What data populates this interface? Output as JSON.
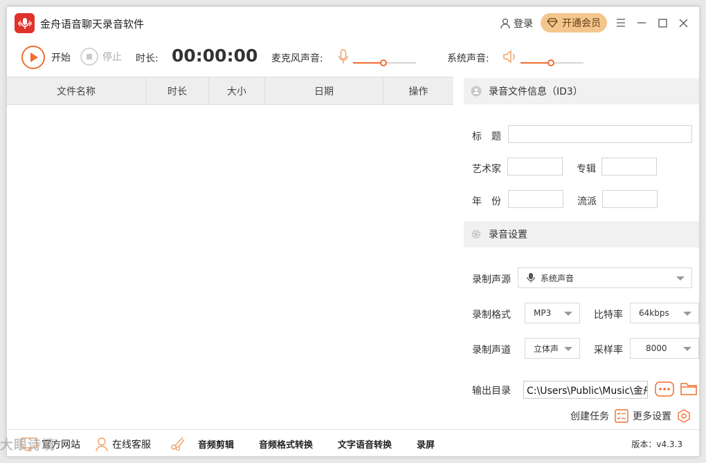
{
  "app": {
    "title": "金舟语音聊天录音软件"
  },
  "header": {
    "login": "登录",
    "vip": "开通会员"
  },
  "toolbar": {
    "start": "开始",
    "stop": "停止",
    "duration_label": "时长:",
    "duration": "00:00:00",
    "mic_label": "麦克风声音:",
    "mic_level": 0.48,
    "system_label": "系统声音:",
    "system_level": 0.48
  },
  "list": {
    "columns": [
      "文件名称",
      "时长",
      "大小",
      "日期",
      "操作"
    ]
  },
  "id3": {
    "header": "录音文件信息（ID3）",
    "title_label": "标　题",
    "artist_label": "艺术家",
    "album_label": "专辑",
    "year_label": "年　份",
    "genre_label": "流派"
  },
  "settings": {
    "header": "录音设置",
    "source_label": "录制声源",
    "source_value": "系统声音",
    "format_label": "录制格式",
    "format_value": "MP3",
    "bitrate_label": "比特率",
    "bitrate_value": "64kbps",
    "channel_label": "录制声道",
    "channel_value": "立体声",
    "samplerate_label": "采样率",
    "samplerate_value": "8000",
    "output_label": "输出目录",
    "output_value": "C:\\Users\\Public\\Music\\金舟",
    "create_task": "创建任务",
    "more_settings": "更多设置"
  },
  "footer": {
    "website": "官方网站",
    "support": "在线客服",
    "audio_edit": "音频剪辑",
    "format_convert": "音频格式转换",
    "tts": "文字语音转换",
    "screen_record": "录屏",
    "version": "版本：v4.3.3"
  },
  "watermark": "大眼诗境",
  "colors": {
    "accent": "#ef6c2d",
    "vip": "#f3c68e",
    "logo": "#e0322c"
  }
}
